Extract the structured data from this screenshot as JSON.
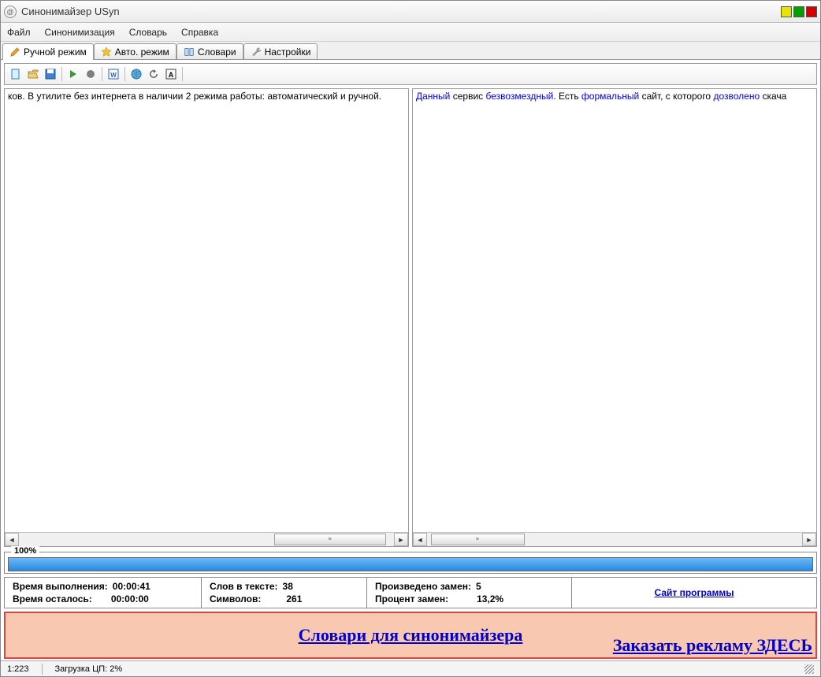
{
  "title": "Синонимайзер USyn",
  "menus": [
    "Файл",
    "Синонимизация",
    "Словарь",
    "Справка"
  ],
  "tabs": [
    {
      "label": "Ручной режим",
      "icon": "pencil-icon"
    },
    {
      "label": "Авто. режим",
      "icon": "star-icon"
    },
    {
      "label": "Словари",
      "icon": "book-icon"
    },
    {
      "label": "Настройки",
      "icon": "wrench-icon"
    }
  ],
  "toolbar_icons": [
    "new-file-icon",
    "open-file-icon",
    "save-icon",
    "sep",
    "run-icon",
    "stop-icon",
    "sep",
    "export-word-icon",
    "sep",
    "globe-icon",
    "refresh-icon",
    "font-icon"
  ],
  "left_text": "ков. В утилите без интернета в наличии 2 режима работы: автоматический и ручной.",
  "right_text": {
    "w1": "Данный",
    "t1": " сервис ",
    "w2": "безвозмездный",
    "t2": ". Есть ",
    "w3": "формальный",
    "t3": " сайт, с которого ",
    "w4": "дозволено",
    "t4": " скача"
  },
  "progress_label": "100%",
  "stats": {
    "exec_time_label": "Время выполнения:",
    "exec_time": "00:00:41",
    "remain_label": "Время осталось:",
    "remain": "00:00:00",
    "words_label": "Слов в тексте:",
    "words": "38",
    "chars_label": "Символов:",
    "chars": "261",
    "replaced_label": "Произведено замен:",
    "replaced": "5",
    "percent_label": "Процент замен:",
    "percent": "13,2%",
    "site_link": "Сайт программы"
  },
  "banner": {
    "text": "Словари для синонимайзера",
    "ad": "Заказать рекламу ЗДЕСЬ"
  },
  "status": {
    "pos": "1:223",
    "cpu": "Загрузка ЦП: 2%"
  }
}
